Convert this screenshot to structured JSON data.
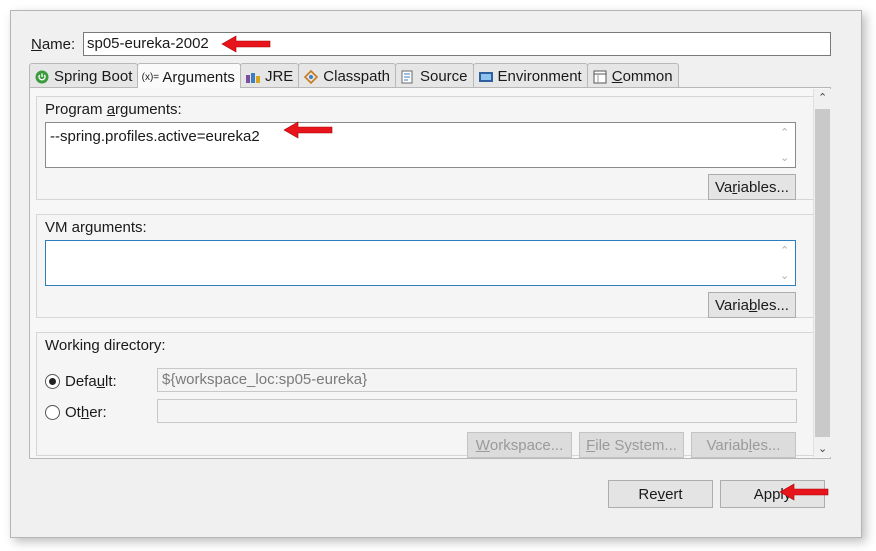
{
  "name_field": {
    "label": "Name:",
    "value": "sp05-eureka-2002"
  },
  "tabs": [
    {
      "label": "Spring Boot",
      "icon": "spring-boot-icon"
    },
    {
      "label": "Arguments",
      "icon": "arguments-icon"
    },
    {
      "label": "JRE",
      "icon": "jre-icon"
    },
    {
      "label": "Classpath",
      "icon": "classpath-icon"
    },
    {
      "label": "Source",
      "icon": "source-icon"
    },
    {
      "label": "Environment",
      "icon": "environment-icon"
    },
    {
      "label": "Common",
      "icon": "common-icon"
    }
  ],
  "program_arguments": {
    "title": "Program arguments:",
    "value": "--spring.profiles.active=eureka2",
    "variables_button": "Variables..."
  },
  "vm_arguments": {
    "title": "VM arguments:",
    "value": "",
    "variables_button": "Variables..."
  },
  "working_directory": {
    "title": "Working directory:",
    "default_label": "Default:",
    "default_value": "${workspace_loc:sp05-eureka}",
    "other_label": "Other:",
    "other_value": "",
    "buttons": {
      "workspace": "Workspace...",
      "file_system": "File System...",
      "variables": "Variables..."
    }
  },
  "footer": {
    "revert": "Revert",
    "apply": "Apply"
  },
  "colors": {
    "annotation_arrow": "#e8141b",
    "focus_border": "#2c7fbf"
  }
}
